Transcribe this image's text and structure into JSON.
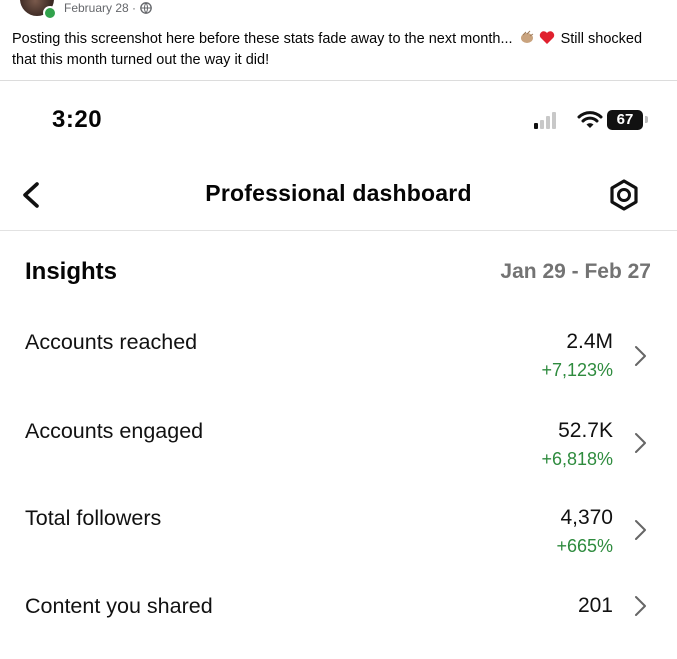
{
  "post": {
    "date": "February 28 ·",
    "text_before_emoji": "Posting this screenshot here before these stats fade away to the next month... ",
    "text_after_emoji": " Still shocked that this month turned out the way it did!",
    "emojis": [
      "clapping-hands-emoji",
      "red-heart-emoji"
    ],
    "privacy_icon": "globe-icon"
  },
  "status_bar": {
    "time": "3:20",
    "battery": "67",
    "icons": [
      "cellular-signal-icon",
      "wifi-icon",
      "battery-icon"
    ]
  },
  "nav": {
    "title": "Professional dashboard",
    "back_icon": "chevron-left-icon",
    "settings_icon": "settings-icon"
  },
  "insights": {
    "heading": "Insights",
    "date_range": "Jan 29 - Feb 27",
    "rows": [
      {
        "label": "Accounts reached",
        "value": "2.4M",
        "change": "+7,123%"
      },
      {
        "label": "Accounts engaged",
        "value": "52.7K",
        "change": "+6,818%"
      },
      {
        "label": "Total followers",
        "value": "4,370",
        "change": "+665%"
      },
      {
        "label": "Content you shared",
        "value": "201",
        "change": ""
      }
    ]
  },
  "colors": {
    "positive_change": "#2e8b3e",
    "secondary_text": "#737373",
    "online_dot": "#31a24c"
  }
}
